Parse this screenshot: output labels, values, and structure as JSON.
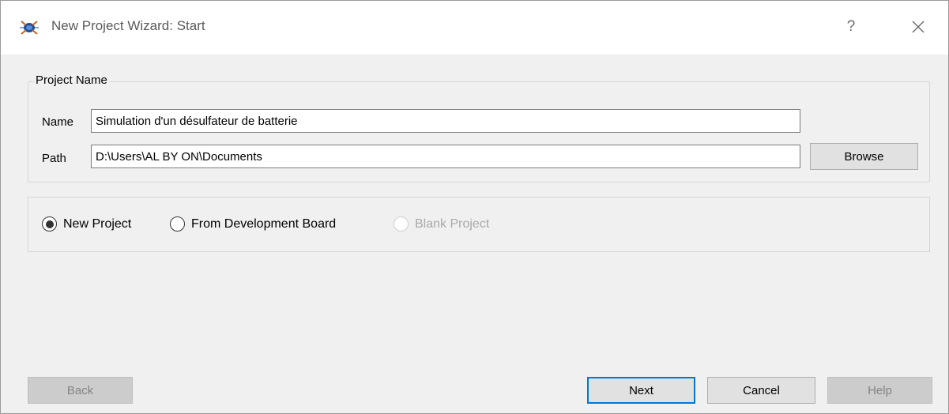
{
  "window": {
    "title": "New Project Wizard: Start",
    "help_label": "?"
  },
  "project_group": {
    "legend": "Project Name",
    "name_label": "Name",
    "name_value": "Simulation d'un désulfateur de batterie",
    "path_label": "Path",
    "path_value": "D:\\Users\\AL BY ON\\Documents",
    "browse_label": "Browse"
  },
  "project_type": {
    "options": [
      {
        "label": "New Project",
        "selected": true,
        "enabled": true
      },
      {
        "label": "From Development Board",
        "selected": false,
        "enabled": true
      },
      {
        "label": "Blank Project",
        "selected": false,
        "enabled": false
      }
    ]
  },
  "footer": {
    "back_label": "Back",
    "next_label": "Next",
    "cancel_label": "Cancel",
    "help_label": "Help"
  },
  "icons": {
    "app": "proteus-app-icon",
    "close": "close-icon"
  },
  "colors": {
    "accent": "#0078d7",
    "window_bg": "#f0f0f0"
  }
}
